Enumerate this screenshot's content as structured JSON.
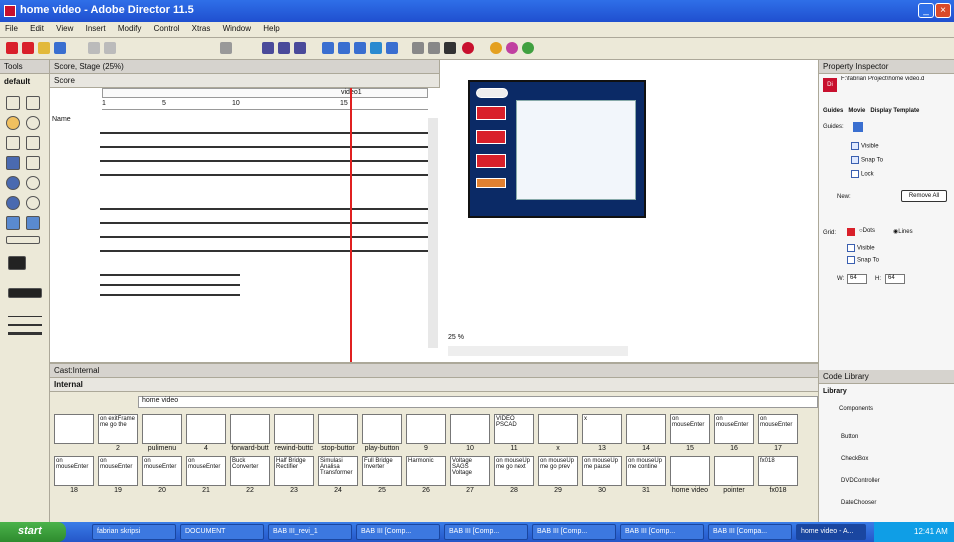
{
  "window": {
    "title": "home video - Adobe Director 11.5"
  },
  "menu": [
    "File",
    "Edit",
    "View",
    "Insert",
    "Modify",
    "Control",
    "Xtras",
    "Window",
    "Help"
  ],
  "tools": {
    "header": "Tools",
    "preset": "default"
  },
  "score": {
    "title": "Score, Stage (25%)",
    "tab": "Score",
    "marker": "video1",
    "frames": [
      "1",
      "5",
      "10",
      "15"
    ],
    "name_col": "Name"
  },
  "stage": {
    "zoom": "25 %"
  },
  "property_inspector": {
    "title": "Property Inspector",
    "path": "F:\\fabrian Project\\home video.d",
    "tabs": [
      "Guides",
      "Movie",
      "Display Template"
    ],
    "guides_label": "Guides:",
    "visible": "Visible",
    "snap_to": "Snap To",
    "lock": "Lock",
    "new_label": "New:",
    "remove_all": "Remove All",
    "grid_label": "Grid:",
    "dots": "Dots",
    "lines": "Lines",
    "grid_visible": "Visible",
    "grid_snap": "Snap To",
    "w_label": "W:",
    "w_value": "64",
    "h_label": "H:",
    "h_value": "64"
  },
  "cast": {
    "title": "Cast:Internal",
    "tab": "Internal",
    "search_value": "home video",
    "row1": [
      {
        "text": "",
        "num": ""
      },
      {
        "text": "on exitFrame me go the",
        "num": "2"
      },
      {
        "text": "",
        "num": "pulimenu"
      },
      {
        "text": "",
        "num": "4"
      },
      {
        "text": "",
        "num": "forward-butt"
      },
      {
        "text": "",
        "num": "rewind-buttc"
      },
      {
        "text": "",
        "num": "stop-buttor"
      },
      {
        "text": "",
        "num": "play-button"
      },
      {
        "text": "",
        "num": "9"
      },
      {
        "text": "",
        "num": "10"
      },
      {
        "text": "VIDEO PSCAD",
        "num": "11"
      },
      {
        "text": "",
        "num": "x"
      },
      {
        "text": "x",
        "num": "13"
      },
      {
        "text": "",
        "num": "14"
      },
      {
        "text": "on mouseEnter",
        "num": "15"
      },
      {
        "text": "on mouseEnter",
        "num": "16"
      },
      {
        "text": "on mouseEnter",
        "num": "17"
      }
    ],
    "row2": [
      {
        "text": "on mouseEnter",
        "num": "18"
      },
      {
        "text": "on mouseEnter",
        "num": "19"
      },
      {
        "text": "on mouseEnter",
        "num": "20"
      },
      {
        "text": "on mouseEnter",
        "num": "21"
      },
      {
        "text": "Buck Converter",
        "num": "22"
      },
      {
        "text": "Half Bridge Rectifier",
        "num": "23"
      },
      {
        "text": "Simulasi Analisa Transformer",
        "num": "24"
      },
      {
        "text": "Full Bridge Inverter",
        "num": "25"
      },
      {
        "text": "Harmonic",
        "num": "26"
      },
      {
        "text": "Voltage SAGS Voltage",
        "num": "27"
      },
      {
        "text": "on mouseUp me go next",
        "num": "28"
      },
      {
        "text": "on mouseUp me go prev",
        "num": "29"
      },
      {
        "text": "on mouseUp me pause",
        "num": "30"
      },
      {
        "text": "on mouseUp me contine",
        "num": "31"
      },
      {
        "text": "",
        "num": "home video"
      },
      {
        "text": "",
        "num": "pointer"
      },
      {
        "text": "fx018",
        "num": "fx018"
      }
    ]
  },
  "code_library": {
    "title": "Code Library",
    "tab": "Library",
    "category": "Components",
    "items": [
      "Button",
      "CheckBox",
      "DVDController",
      "DateChooser"
    ]
  },
  "taskbar": {
    "start": "start",
    "tasks": [
      "fabrian skripsi",
      "DOCUMENT",
      "BAB III_revi_1",
      "BAB III [Comp...",
      "BAB III [Comp...",
      "BAB III [Comp...",
      "BAB III [Comp...",
      "BAB III [Compa...",
      "home video - A..."
    ],
    "clock": "12:41 AM"
  },
  "colors": {
    "accent": "#2456c8",
    "playhead": "#e02020",
    "stage_bg": "#0b2a66"
  }
}
